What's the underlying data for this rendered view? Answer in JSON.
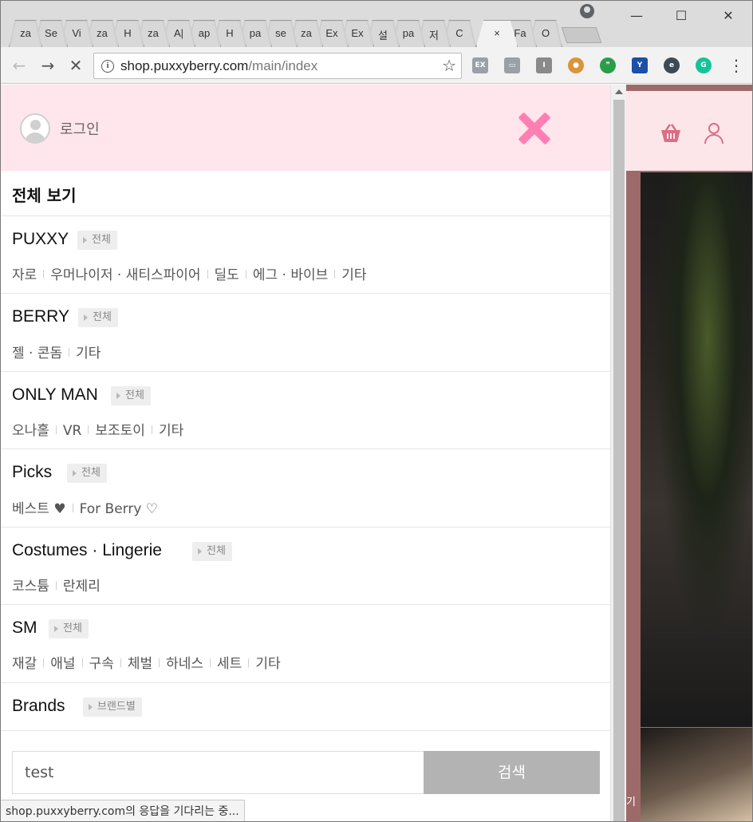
{
  "browser": {
    "tabs": [
      {
        "label": "za"
      },
      {
        "label": "Se"
      },
      {
        "label": "Vi"
      },
      {
        "label": "za"
      },
      {
        "label": "H"
      },
      {
        "label": "za"
      },
      {
        "label": "A|"
      },
      {
        "label": "ap"
      },
      {
        "label": "H"
      },
      {
        "label": "pa"
      },
      {
        "label": "se"
      },
      {
        "label": "za"
      },
      {
        "label": "Ex"
      },
      {
        "label": "Ex"
      },
      {
        "label": "설"
      },
      {
        "label": "pa"
      },
      {
        "label": "저"
      },
      {
        "label": "C"
      },
      {
        "label": "×"
      },
      {
        "label": "Fa"
      },
      {
        "label": "O"
      }
    ],
    "url_host": "shop.puxxyberry.com",
    "url_path": "/main/index",
    "status_text": "shop.puxxyberry.com의 응답을 기다리는 중...",
    "extensions": [
      {
        "icon": "ex-icon",
        "text": "EX",
        "color": "#9aa0a6"
      },
      {
        "icon": "screen-icon",
        "text": "▭",
        "color": "#9aa0a6"
      },
      {
        "icon": "i-icon",
        "text": "I",
        "color": "#8a8a8a"
      },
      {
        "icon": "cookie-icon",
        "text": "●",
        "color": "#d8953b"
      },
      {
        "icon": "quote-icon",
        "text": "❞",
        "color": "#2a9d4a"
      },
      {
        "icon": "y-icon",
        "text": "Y",
        "color": "#1b4fa8"
      },
      {
        "icon": "e-icon",
        "text": "e",
        "color": "#3b4a57"
      },
      {
        "icon": "grammarly-icon",
        "text": "G",
        "color": "#15c39a"
      }
    ]
  },
  "menu": {
    "login_label": "로그인",
    "all_view": "전체 보기",
    "categories": [
      {
        "title": "PUXXY",
        "badge": "전체",
        "subs": [
          "자로",
          "우머나이저 · 새티스파이어",
          "딜도",
          "에그 · 바이브",
          "기타"
        ]
      },
      {
        "title": "BERRY",
        "badge": "전체",
        "subs": [
          "젤 · 콘돔",
          "기타"
        ]
      },
      {
        "title": "ONLY MAN",
        "badge": "전체",
        "subs": [
          "오나홀",
          "VR",
          "보조토이",
          "기타"
        ]
      },
      {
        "title": "Picks",
        "badge": "전체",
        "subs": [
          "베스트 ♥",
          "For Berry ♡"
        ]
      },
      {
        "title": "Costumes · Lingerie",
        "badge": "전체",
        "subs": [
          "코스튬",
          "란제리"
        ]
      },
      {
        "title": "SM",
        "badge": "전체",
        "subs": [
          "재갈",
          "애널",
          "구속",
          "체벌",
          "하네스",
          "세트",
          "기타"
        ]
      },
      {
        "title": "Brands",
        "badge": "브랜드별",
        "subs": []
      }
    ],
    "search": {
      "value": "test",
      "button": "검색"
    }
  },
  "background_page": {
    "more_label": "기"
  },
  "colors": {
    "accent_pink": "#ff7fb3",
    "header_bg": "#ffe5ec",
    "search_button": "#b3b3b3"
  }
}
